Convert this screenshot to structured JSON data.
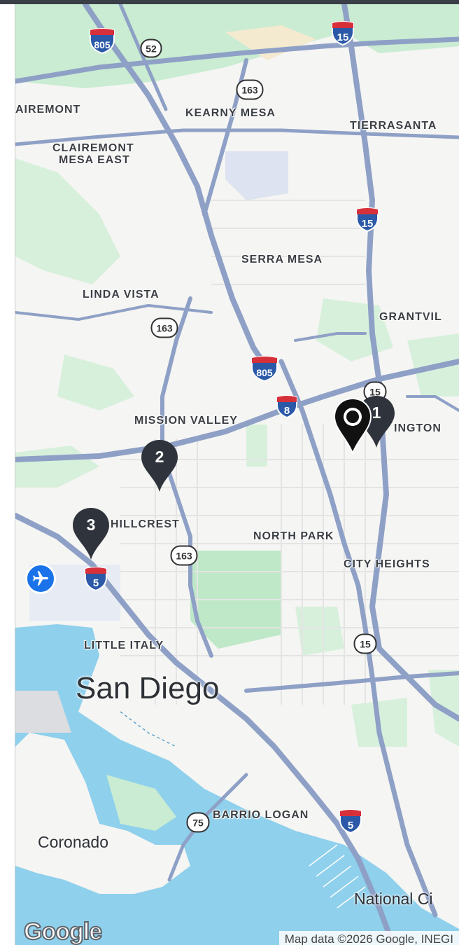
{
  "map": {
    "neighborhoods": {
      "clairemont": "AIREMONT",
      "kearny_mesa": "KEARNY MESA",
      "tierrasanta": "TIERRASANTA",
      "clairemont_mesa_east_1": "CLAIREMONT",
      "clairemont_mesa_east_2": "MESA EAST",
      "serra_mesa": "SERRA MESA",
      "linda_vista": "LINDA VISTA",
      "grantville": "GRANTVIL",
      "mission_valley": "MISSION VALLEY",
      "kensington": "INGTON",
      "hillcrest": "HILLCREST",
      "north_park": "NORTH PARK",
      "city_heights": "CITY HEIGHTS",
      "little_italy": "LITTLE ITALY",
      "barrio_logan": "BARRIO LOGAN"
    },
    "cities": {
      "san_diego": "San Diego",
      "coronado": "Coronado",
      "national_city": "National Ci"
    },
    "highways": {
      "i805_top": "805",
      "sr52": "52",
      "i15_top": "15",
      "sr163_top": "163",
      "i15_mid": "15",
      "sr163_mid": "163",
      "i805_mid": "805",
      "i8": "8",
      "sr15_small": "15",
      "sr163_low": "163",
      "i5_left": "5",
      "sr15_low": "15",
      "sr75": "75",
      "i5_bottom": "5"
    },
    "markers": {
      "m1": "1",
      "m2": "2",
      "m3": "3"
    },
    "icons": {
      "airport": "airplane-icon",
      "selected_pin": "location-pin-icon"
    },
    "colors": {
      "water": "#8fd0ec",
      "park": "#c9ecd2",
      "highway": "#8ea0c6",
      "marker": "#2f343c",
      "interstate_red": "#d6313b",
      "interstate_blue": "#2b59a8"
    },
    "logo": "Google",
    "attribution": "Map data ©2026 Google, INEGI"
  }
}
